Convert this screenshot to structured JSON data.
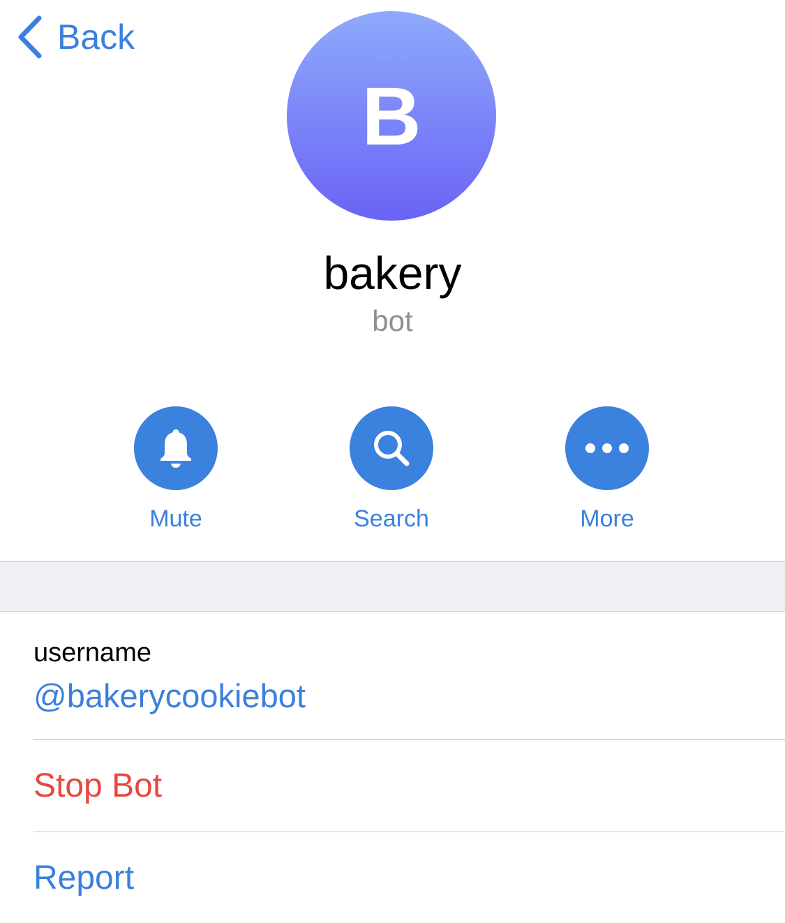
{
  "nav": {
    "back_label": "Back"
  },
  "profile": {
    "avatar_initial": "B",
    "avatar_gradient": [
      "#8eaafb",
      "#6a63f6"
    ],
    "name": "bakery",
    "status": "bot"
  },
  "actions": [
    {
      "label": "Mute",
      "icon": "bell-icon"
    },
    {
      "label": "Search",
      "icon": "search-icon"
    },
    {
      "label": "More",
      "icon": "more-icon"
    }
  ],
  "info": {
    "username_label": "username",
    "username_value": "@bakerycookiebot"
  },
  "rows": {
    "stop_bot": "Stop Bot",
    "report": "Report"
  },
  "colors": {
    "accent": "#3b80de",
    "destructive": "#e5483e",
    "secondary_text": "#8e8e93",
    "section_background": "#efeff4"
  }
}
